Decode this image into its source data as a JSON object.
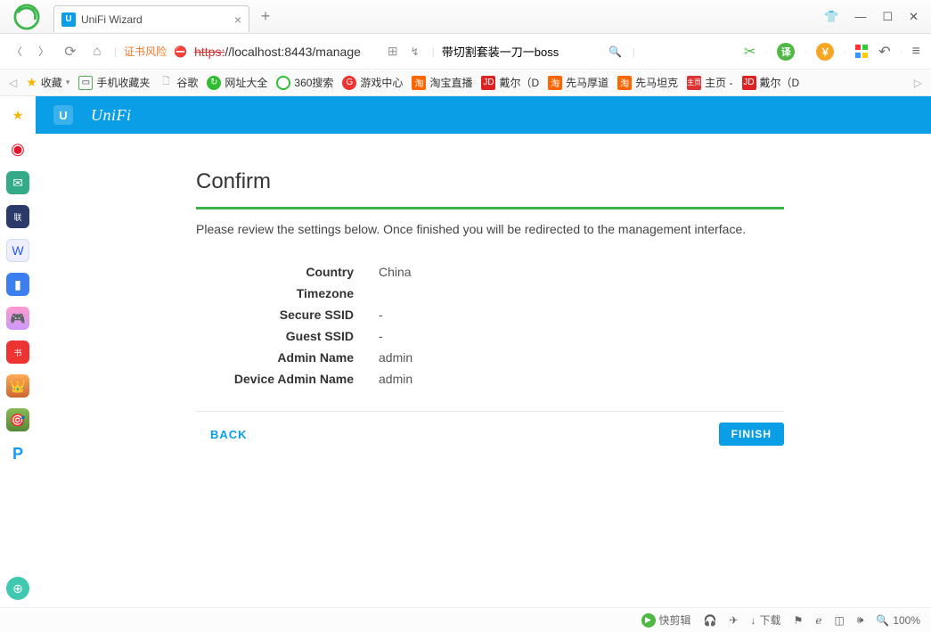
{
  "tab": {
    "title": "UniFi Wizard",
    "favicon": "U"
  },
  "address": {
    "cert_warning": "证书风险",
    "url_strike": "https:",
    "url_rest": "//localhost:8443/manage",
    "search_value": "带切割套装一刀一boss"
  },
  "bookmarks": {
    "fav_label": "收藏",
    "items": [
      {
        "label": "手机收藏夹"
      },
      {
        "label": "谷歌"
      },
      {
        "label": "网址大全"
      },
      {
        "label": "360搜索"
      },
      {
        "label": "游戏中心"
      },
      {
        "label": "淘宝直播"
      },
      {
        "label": "戴尔（D"
      },
      {
        "label": "先马厚道"
      },
      {
        "label": "先马坦克"
      },
      {
        "label": "主页 -"
      },
      {
        "label": "戴尔（D"
      }
    ]
  },
  "unifi": {
    "mark": "U",
    "logo": "UniFi"
  },
  "confirm": {
    "title": "Confirm",
    "instruction": "Please review the settings below. Once finished you will be redirected to the management interface.",
    "fields": [
      {
        "label": "Country",
        "value": "China"
      },
      {
        "label": "Timezone",
        "value": ""
      },
      {
        "label": "Secure SSID",
        "value": "-"
      },
      {
        "label": "Guest SSID",
        "value": "-"
      },
      {
        "label": "Admin Name",
        "value": "admin"
      },
      {
        "label": "Device Admin Name",
        "value": "admin"
      }
    ],
    "back": "BACK",
    "finish": "FINISH"
  },
  "status": {
    "clip": "快剪辑",
    "download": "下载",
    "zoom": "100%"
  }
}
